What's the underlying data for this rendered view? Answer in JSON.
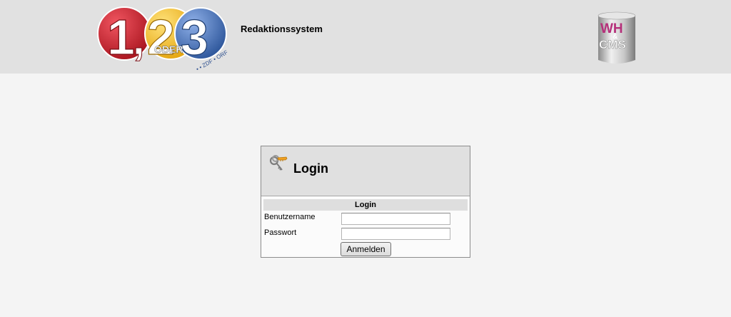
{
  "header": {
    "logo_left": {
      "big_text_1": "1",
      "big_text_2": "2",
      "big_text_3": "3",
      "comma": ",",
      "oder": "ODER",
      "sub": "• • ZDF • ORF"
    },
    "system_title": "Redaktionssystem",
    "logo_right": {
      "line1": "WH",
      "amp": "&",
      "line2": "CMS"
    }
  },
  "login": {
    "panel_title": "Login",
    "form_header": "Login",
    "username_label": "Benutzername",
    "username_value": "",
    "password_label": "Passwort",
    "password_value": "",
    "submit_label": "Anmelden"
  },
  "colors": {
    "header_bg": "#e1e1e1",
    "page_bg": "#f4f4f4",
    "logo_red": "#c8202c",
    "logo_yellow": "#f2b81e",
    "logo_blue": "#3e6fb5",
    "cms_pink": "#b5307a"
  }
}
